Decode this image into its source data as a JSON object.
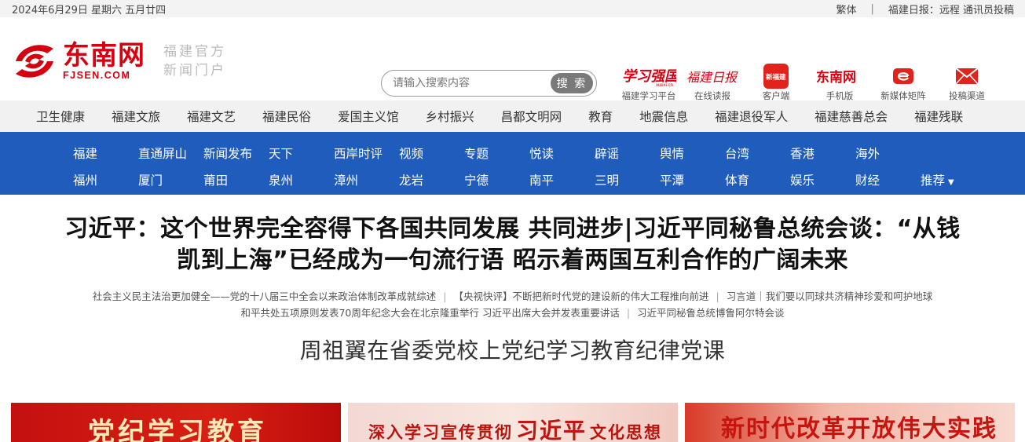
{
  "topbar": {
    "date": "2024年6月29日  星期六  五月廿四",
    "traditional": "繁体",
    "sep": "|",
    "remote_label": "福建日报：远程 通讯员投稿"
  },
  "logo": {
    "cn": "东南网",
    "en": "FJSEN.COM",
    "slogan1": "福建官方",
    "slogan2": "新闻门户"
  },
  "search": {
    "placeholder": "请输入搜索内容",
    "button": "搜 索"
  },
  "quick_links": [
    {
      "label": "福建学习平台",
      "icon": "xuexi-icon"
    },
    {
      "label": "在线读报",
      "icon": "fujian-daily-icon"
    },
    {
      "label": "客户端",
      "icon": "app-icon"
    },
    {
      "label": "手机版",
      "icon": "mobile-site-icon"
    },
    {
      "label": "新媒体矩阵",
      "icon": "new-media-icon"
    },
    {
      "label": "投稿渠道",
      "icon": "mail-icon"
    }
  ],
  "quick_logos": {
    "xuexi": "学习强国",
    "xuexi_sub": "xuexi.cn",
    "daily": "福建日报",
    "app": "新福建",
    "mobile": "东南网"
  },
  "channels": [
    "卫生健康",
    "福建文旅",
    "福建文艺",
    "福建民俗",
    "爱国主义馆",
    "乡村振兴",
    "昌都文明网",
    "教育",
    "地震信息",
    "福建退役军人",
    "福建慈善总会",
    "福建残联"
  ],
  "nav_row1": [
    "福建",
    "直通屏山",
    "新闻发布",
    "天下",
    "西岸时评",
    "视频",
    "专题",
    "悦读",
    "辟谣",
    "舆情",
    "台湾",
    "香港",
    "海外"
  ],
  "nav_row2": [
    "福州",
    "厦门",
    "莆田",
    "泉州",
    "漳州",
    "龙岩",
    "宁德",
    "南平",
    "三明",
    "平潭",
    "体育",
    "娱乐",
    "财经",
    "推荐"
  ],
  "headline": {
    "line1": "习近平：这个世界完全容得下各国共同发展 共同进步|习近平同秘鲁总统会谈：“从钱",
    "line2": "凯到上海”已经成为一句流行语 昭示着两国互利合作的广阔未来"
  },
  "sub_links_row1": [
    "社会主义民主法治更加健全——党的十八届三中全会以来政治体制改革成就综述",
    "【央视快评】不断把新时代党的建设新的伟大工程推向前进",
    "习言道｜我们要以同球共济精神珍爱和呵护地球"
  ],
  "sub_links_row2": [
    "和平共处五项原则发表70周年纪念大会在北京隆重举行 习近平出席大会并发表重要讲话",
    "习近平同秘鲁总统博鲁阿尔特会谈"
  ],
  "feature": "周祖翼在省委党校上党纪学习教育纪律党课",
  "banners": {
    "b1": "党纪学习教育",
    "b2_pre": "深入学习宣传贯彻",
    "b2_big": "习近平",
    "b2_post": "文化思想",
    "b3": "新时代改革开放伟大实践"
  },
  "colors": {
    "brand_red": "#d7000f",
    "nav_blue": "#1f5cbb",
    "channel_bg": "#f1f1f1"
  }
}
